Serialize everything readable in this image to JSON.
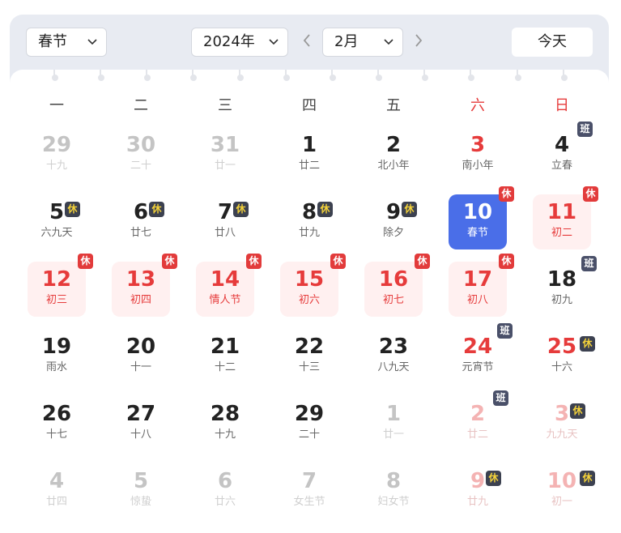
{
  "toolbar": {
    "holiday_select": "春节",
    "year_select": "2024年",
    "month_select": "2月",
    "today_label": "今天"
  },
  "weekdays": [
    {
      "label": "一",
      "weekend": false
    },
    {
      "label": "二",
      "weekend": false
    },
    {
      "label": "三",
      "weekend": false
    },
    {
      "label": "四",
      "weekend": false
    },
    {
      "label": "五",
      "weekend": false
    },
    {
      "label": "六",
      "weekend": true
    },
    {
      "label": "日",
      "weekend": true
    }
  ],
  "days": [
    {
      "num": "29",
      "lunar": "十九",
      "other": true,
      "weekend": false,
      "badge": null
    },
    {
      "num": "30",
      "lunar": "二十",
      "other": true,
      "weekend": false,
      "badge": null
    },
    {
      "num": "31",
      "lunar": "廿一",
      "other": true,
      "weekend": false,
      "badge": null
    },
    {
      "num": "1",
      "lunar": "廿二",
      "other": false,
      "weekend": false,
      "badge": null
    },
    {
      "num": "2",
      "lunar": "北小年",
      "other": false,
      "weekend": false,
      "badge": null
    },
    {
      "num": "3",
      "lunar": "南小年",
      "other": false,
      "weekend": true,
      "badge": null
    },
    {
      "num": "4",
      "lunar": "立春",
      "other": false,
      "weekend": false,
      "badge": "班"
    },
    {
      "num": "5",
      "lunar": "六九天",
      "other": false,
      "weekend": false,
      "badge": "休dark"
    },
    {
      "num": "6",
      "lunar": "廿七",
      "other": false,
      "weekend": false,
      "badge": "休dark"
    },
    {
      "num": "7",
      "lunar": "廿八",
      "other": false,
      "weekend": false,
      "badge": "休dark"
    },
    {
      "num": "8",
      "lunar": "廿九",
      "other": false,
      "weekend": false,
      "badge": "休dark"
    },
    {
      "num": "9",
      "lunar": "除夕",
      "other": false,
      "weekend": false,
      "badge": "休dark"
    },
    {
      "num": "10",
      "lunar": "春节",
      "other": false,
      "weekend": true,
      "badge": "休",
      "selected": true
    },
    {
      "num": "11",
      "lunar": "初二",
      "other": false,
      "weekend": true,
      "badge": "休",
      "holiday": true
    },
    {
      "num": "12",
      "lunar": "初三",
      "other": false,
      "weekend": false,
      "badge": "休",
      "holiday": true
    },
    {
      "num": "13",
      "lunar": "初四",
      "other": false,
      "weekend": false,
      "badge": "休",
      "holiday": true
    },
    {
      "num": "14",
      "lunar": "情人节",
      "other": false,
      "weekend": false,
      "badge": "休",
      "holiday": true
    },
    {
      "num": "15",
      "lunar": "初六",
      "other": false,
      "weekend": false,
      "badge": "休",
      "holiday": true
    },
    {
      "num": "16",
      "lunar": "初七",
      "other": false,
      "weekend": false,
      "badge": "休",
      "holiday": true
    },
    {
      "num": "17",
      "lunar": "初八",
      "other": false,
      "weekend": true,
      "badge": "休",
      "holiday": true
    },
    {
      "num": "18",
      "lunar": "初九",
      "other": false,
      "weekend": false,
      "badge": "班"
    },
    {
      "num": "19",
      "lunar": "雨水",
      "other": false,
      "weekend": false,
      "badge": null
    },
    {
      "num": "20",
      "lunar": "十一",
      "other": false,
      "weekend": false,
      "badge": null
    },
    {
      "num": "21",
      "lunar": "十二",
      "other": false,
      "weekend": false,
      "badge": null
    },
    {
      "num": "22",
      "lunar": "十三",
      "other": false,
      "weekend": false,
      "badge": null
    },
    {
      "num": "23",
      "lunar": "八九天",
      "other": false,
      "weekend": false,
      "badge": null
    },
    {
      "num": "24",
      "lunar": "元宵节",
      "other": false,
      "weekend": true,
      "badge": "班"
    },
    {
      "num": "25",
      "lunar": "十六",
      "other": false,
      "weekend": true,
      "badge": "休dark"
    },
    {
      "num": "26",
      "lunar": "十七",
      "other": false,
      "weekend": false,
      "badge": null
    },
    {
      "num": "27",
      "lunar": "十八",
      "other": false,
      "weekend": false,
      "badge": null
    },
    {
      "num": "28",
      "lunar": "十九",
      "other": false,
      "weekend": false,
      "badge": null
    },
    {
      "num": "29",
      "lunar": "二十",
      "other": false,
      "weekend": false,
      "badge": null
    },
    {
      "num": "1",
      "lunar": "廿一",
      "other": true,
      "weekend": false,
      "badge": null
    },
    {
      "num": "2",
      "lunar": "廿二",
      "other": true,
      "weekend": true,
      "badge": "班"
    },
    {
      "num": "3",
      "lunar": "九九天",
      "other": true,
      "weekend": true,
      "badge": "休dark"
    },
    {
      "num": "4",
      "lunar": "廿四",
      "other": true,
      "weekend": false,
      "badge": null
    },
    {
      "num": "5",
      "lunar": "惊蛰",
      "other": true,
      "weekend": false,
      "badge": null
    },
    {
      "num": "6",
      "lunar": "廿六",
      "other": true,
      "weekend": false,
      "badge": null
    },
    {
      "num": "7",
      "lunar": "女生节",
      "other": true,
      "weekend": false,
      "badge": null
    },
    {
      "num": "8",
      "lunar": "妇女节",
      "other": true,
      "weekend": false,
      "badge": null
    },
    {
      "num": "9",
      "lunar": "廿九",
      "other": true,
      "weekend": true,
      "badge": "休dark"
    },
    {
      "num": "10",
      "lunar": "初一",
      "other": true,
      "weekend": true,
      "badge": "休dark"
    }
  ],
  "colors": {
    "selected": "#4a6ee8",
    "holiday_bg": "#fff0f0",
    "red": "#e63b3b",
    "work_badge": "#4a5069",
    "frame": "#e8ebf2"
  }
}
